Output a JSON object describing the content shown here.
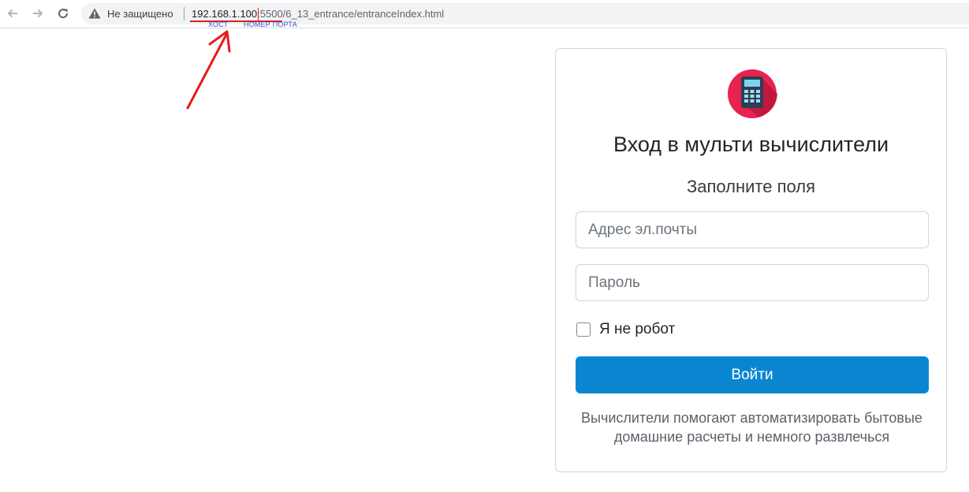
{
  "browser": {
    "security_label": "Не защищено",
    "url_host": "192.168.1.100",
    "url_rest": ":5500/6_13_entrance/entranceIndex.html"
  },
  "annotations": {
    "host_label": "ХОСТ",
    "port_label": "НОМЕР ПОРТА",
    "highlight_color": "#e51c1c"
  },
  "login": {
    "title": "Вход в мульти вычислители",
    "subtitle": "Заполните поля",
    "email_placeholder": "Адрес эл.почты",
    "password_placeholder": "Пароль",
    "robot_label": "Я не робот",
    "robot_checked": false,
    "submit_label": "Войти",
    "footnote": "Вычислители помогают автоматизировать бытовые домашние расчеты и немного развлечься",
    "accent_color": "#0a86d1",
    "logo_icon": "calculator-icon"
  }
}
